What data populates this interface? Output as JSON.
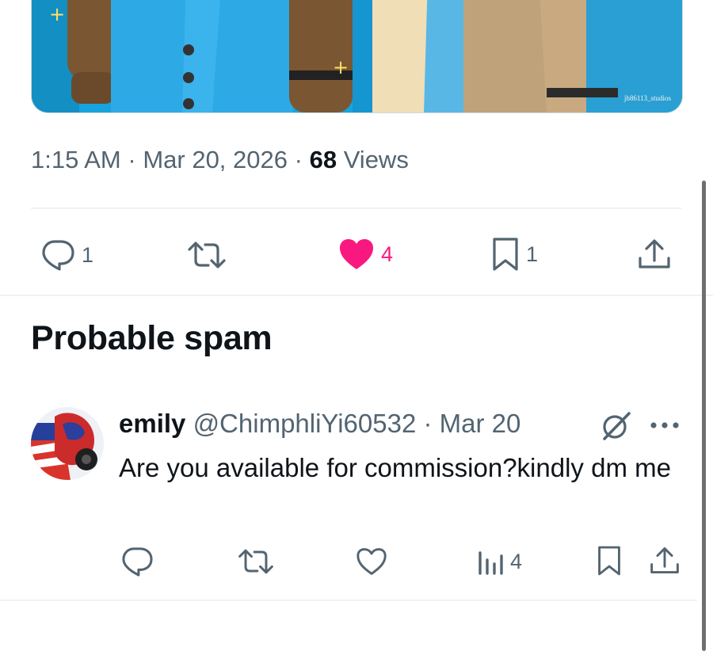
{
  "media": {
    "watermark": "jb86113_studios"
  },
  "tweet": {
    "time": "1:15 AM",
    "date": "Mar 20, 2026",
    "views_count": "68",
    "views_label": "Views",
    "sep": "·"
  },
  "actions": {
    "reply_count": "1",
    "like_count": "4",
    "bookmark_count": "1"
  },
  "section_title": "Probable spam",
  "reply": {
    "name": "emily",
    "handle": "@ChimphliYi60532",
    "sep": "·",
    "date": "Mar 20",
    "text": "Are you available for commission?kindly dm me",
    "views_count": "4"
  },
  "colors": {
    "like": "#f91880",
    "icon": "#536471",
    "media_blue": "#1a9fd8"
  },
  "icons": [
    "reply-icon",
    "retweet-icon",
    "heart-filled-icon",
    "bookmark-icon",
    "share-icon",
    "grok-icon",
    "more-icon",
    "heart-icon",
    "views-icon"
  ]
}
